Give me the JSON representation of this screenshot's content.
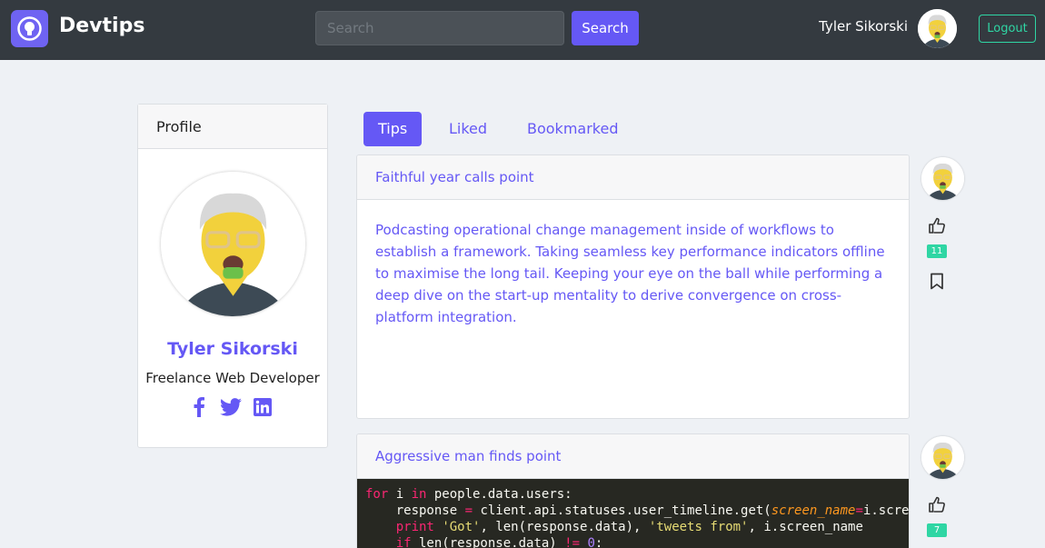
{
  "navbar": {
    "brand": "Devtips",
    "search_placeholder": "Search",
    "search_button": "Search",
    "user_name": "Tyler Sikorski",
    "logout_label": "Logout"
  },
  "profile": {
    "header": "Profile",
    "name": "Tyler Sikorski",
    "role": "Freelance Web Developer",
    "social": [
      "facebook-icon",
      "twitter-icon",
      "linkedin-icon"
    ]
  },
  "tabs": [
    {
      "label": "Tips",
      "active": true
    },
    {
      "label": "Liked",
      "active": false
    },
    {
      "label": "Bookmarked",
      "active": false
    }
  ],
  "tips": [
    {
      "title": "Faithful year calls point",
      "body": "Podcasting operational change management inside of workflows to establish a framework. Taking seamless key performance indicators offline to maximise the long tail. Keeping your eye on the ball while performing a deep dive on the start-up mentality to derive convergence on cross-platform integration.",
      "likes": "11"
    },
    {
      "title": "Aggressive man finds point",
      "code_lines": [
        "for i in people.data.users:",
        "    response = client.api.statuses.user_timeline.get(screen_name=i.scre",
        "    print 'Got', len(response.data), 'tweets from', i.screen_name",
        "    if len(response.data) != 0:"
      ],
      "likes": "7"
    }
  ],
  "colors": {
    "accent": "#6558f5",
    "navbar": "#343a40",
    "success": "#2fd6a4",
    "background": "#eef1f5"
  }
}
